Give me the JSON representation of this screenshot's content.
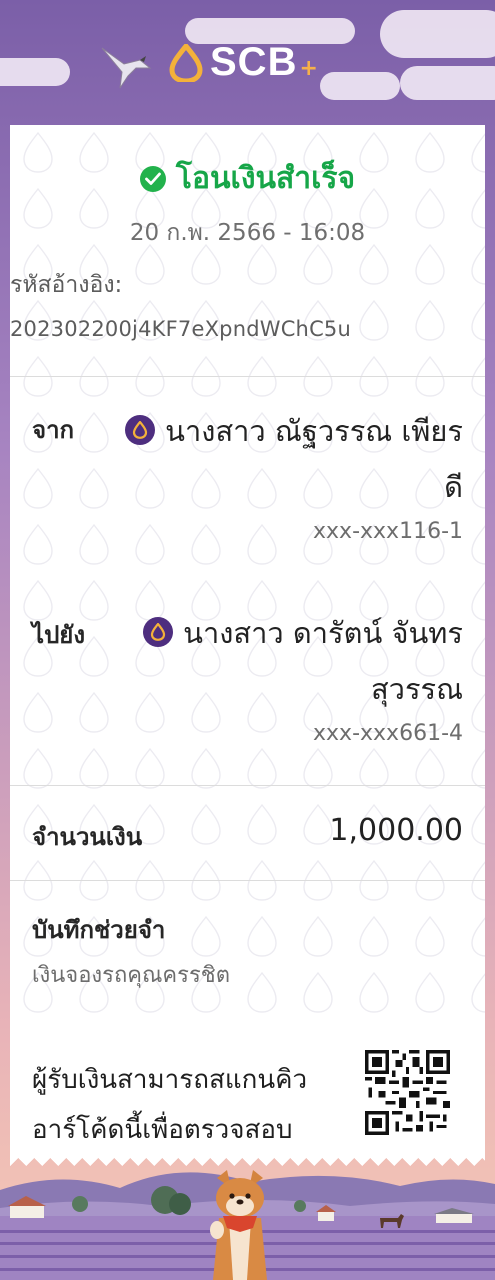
{
  "brand": {
    "name": "SCB",
    "plus": "+"
  },
  "status": {
    "text": "โอนเงินสำเร็จ",
    "color": "#16a648"
  },
  "datetime": "20 ก.พ. 2566 - 16:08",
  "reference": {
    "label": "รหัสอ้างอิง:",
    "value": "202302200j4KF7eXpndWChC5u"
  },
  "from": {
    "label": "จาก",
    "name_line1": "นางสาว ณัฐวรรณ เพียร",
    "name_line2": "ดี",
    "account": "xxx-xxx116-1"
  },
  "to": {
    "label": "ไปยัง",
    "name_line1": "นางสาว ดารัตน์ จันทร",
    "name_line2": "สุวรรณ",
    "account": "xxx-xxx661-4"
  },
  "amount": {
    "label": "จำนวนเงิน",
    "value": "1,000.00"
  },
  "memo": {
    "label": "บันทึกช่วยจำ",
    "value": "เงินจองรถคุณครรชิต"
  },
  "qr": {
    "line1": "ผู้รับเงินสามารถสแกนคิว",
    "line2": "อาร์โค้ดนี้เพื่อตรวจสอบ"
  },
  "icons": {
    "status": "check-circle-icon",
    "bank_badge": "scb-bank-icon",
    "qr": "qr-code-icon",
    "mascot": "shiba-dog-icon",
    "bird": "bird-icon"
  }
}
